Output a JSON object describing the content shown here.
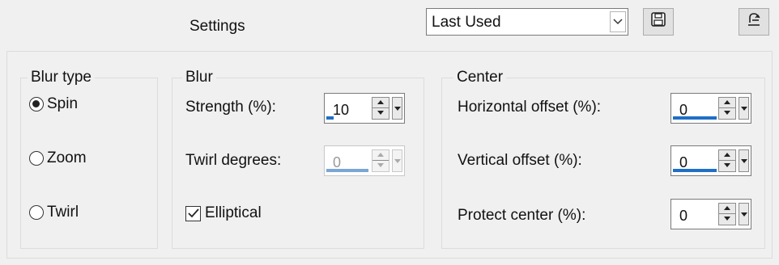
{
  "header": {
    "settings_label": "Settings",
    "preset_value": "Last Used",
    "save_icon": "floppy-disk-icon",
    "reset_icon": "reset-default-icon"
  },
  "blur_type": {
    "title": "Blur type",
    "options": [
      {
        "label": "Spin",
        "checked": true
      },
      {
        "label": "Zoom",
        "checked": false
      },
      {
        "label": "Twirl",
        "checked": false
      }
    ]
  },
  "blur": {
    "title": "Blur",
    "strength_label": "Strength (%):",
    "strength_value": "10",
    "strength_percent": 10,
    "twirl_label": "Twirl degrees:",
    "twirl_value": "0",
    "twirl_enabled": false,
    "elliptical_label": "Elliptical",
    "elliptical_checked": true
  },
  "center": {
    "title": "Center",
    "h_offset_label": "Horizontal offset (%):",
    "h_offset_value": "0",
    "v_offset_label": "Vertical offset (%):",
    "v_offset_value": "0",
    "protect_label": "Protect center (%):",
    "protect_value": "0"
  },
  "colors": {
    "accent": "#1f6fc5"
  }
}
